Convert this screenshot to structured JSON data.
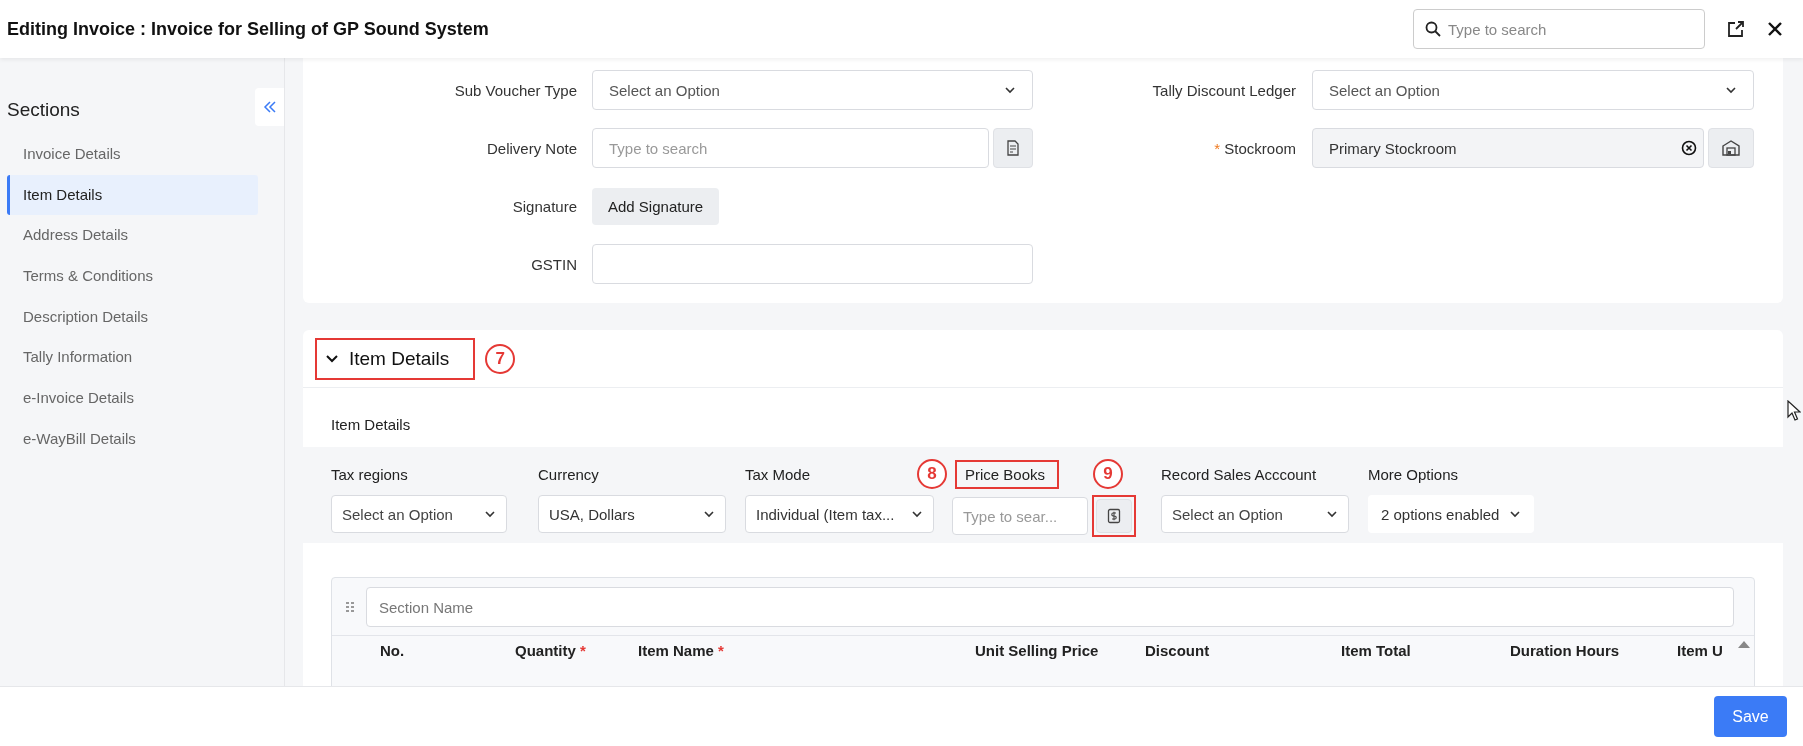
{
  "header": {
    "title": "Editing Invoice : Invoice for Selling of GP Sound System",
    "search": {
      "placeholder": "Type to search"
    }
  },
  "sidebar": {
    "title": "Sections",
    "items": [
      {
        "label": "Invoice Details",
        "selected": false
      },
      {
        "label": "Item Details",
        "selected": true
      },
      {
        "label": "Address Details",
        "selected": false
      },
      {
        "label": "Terms & Conditions",
        "selected": false
      },
      {
        "label": "Description Details",
        "selected": false
      },
      {
        "label": "Tally Information",
        "selected": false
      },
      {
        "label": "e-Invoice Details",
        "selected": false
      },
      {
        "label": "e-WayBill Details",
        "selected": false
      }
    ]
  },
  "form": {
    "left": [
      {
        "kind": "select",
        "label": "Sub Voucher Type",
        "placeholder": "Select an Option"
      },
      {
        "kind": "lookup",
        "label": "Delivery Note",
        "placeholder": "Type to search"
      },
      {
        "kind": "button",
        "label": "Signature",
        "button": "Add Signature"
      },
      {
        "kind": "text",
        "label": "GSTIN"
      }
    ],
    "right": [
      {
        "kind": "select",
        "label": "Tally Discount Ledger",
        "placeholder": "Select an Option"
      },
      {
        "kind": "picked",
        "label": "Stockroom",
        "mark": "*",
        "value": "Primary Stockroom"
      }
    ]
  },
  "item_section": {
    "title": "Item Details",
    "expanded": true,
    "marker": "7",
    "subtitle": "Item Details",
    "options": [
      {
        "kind": "select",
        "label": "Tax regions",
        "placeholder": "Select an Option"
      },
      {
        "kind": "select",
        "label": "Currency",
        "value": "USA, Dollars"
      },
      {
        "kind": "select",
        "label": "Tax Mode",
        "value": "Individual (Item tax..."
      },
      {
        "kind": "lookup",
        "label": "Price Books",
        "placeholder": "Type to sear...",
        "label_marker": "8",
        "button_marker": "9"
      },
      {
        "kind": "select",
        "label": "Record Sales Acccount",
        "placeholder": "Select an Option"
      },
      {
        "kind": "menu",
        "label": "More Options",
        "value": "2 options enabled"
      }
    ],
    "table": {
      "section_name": {
        "placeholder": "Section Name"
      },
      "columns": [
        {
          "label": "No."
        },
        {
          "label": "Quantity",
          "mark": "*"
        },
        {
          "label": "Item Name",
          "mark": "*"
        },
        {
          "label": "Unit Selling Price"
        },
        {
          "label": "Discount"
        },
        {
          "label": "Item Total"
        },
        {
          "label": "Duration Hours"
        },
        {
          "label": "Item U"
        }
      ]
    }
  },
  "footer": {
    "save": "Save"
  }
}
